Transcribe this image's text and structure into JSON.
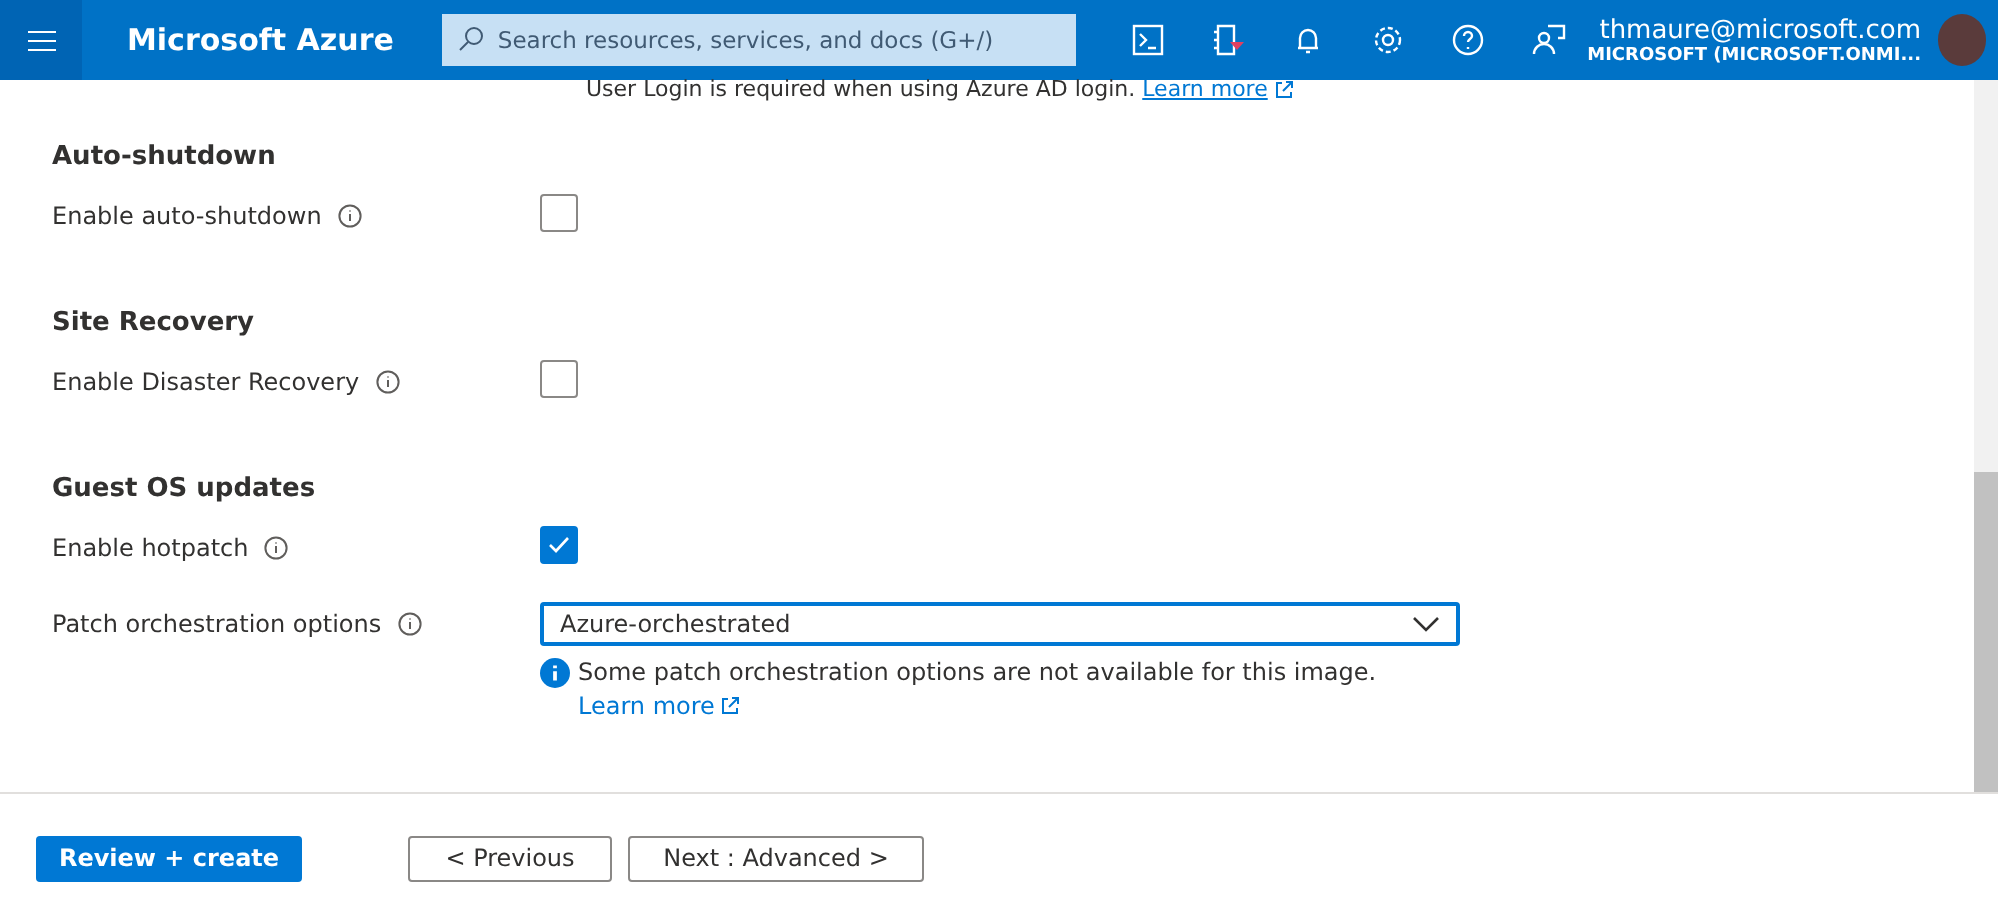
{
  "header": {
    "brand": "Microsoft Azure",
    "search": {
      "placeholder": "Search resources, services, and docs (G+/)"
    },
    "account": {
      "email": "thmaure@microsoft.com",
      "directory": "MICROSOFT (MICROSOFT.ONMI..."
    }
  },
  "top_note": {
    "text": "User Login is required when using Azure AD login.",
    "link": "Learn more"
  },
  "sections": [
    {
      "title": "Auto-shutdown",
      "fields": [
        {
          "kind": "checkbox",
          "label": "Enable auto-shutdown",
          "checked": false
        }
      ]
    },
    {
      "title": "Site Recovery",
      "fields": [
        {
          "kind": "checkbox",
          "label": "Enable Disaster Recovery",
          "checked": false
        }
      ]
    },
    {
      "title": "Guest OS updates",
      "fields": [
        {
          "kind": "checkbox",
          "label": "Enable hotpatch",
          "checked": true
        },
        {
          "kind": "dropdown",
          "label": "Patch orchestration options",
          "value": "Azure-orchestrated",
          "info": "Some patch orchestration options are not available for this image.",
          "link": "Learn more"
        }
      ]
    }
  ],
  "footer": {
    "primary": "Review + create",
    "previous": "< Previous",
    "next": "Next : Advanced >"
  }
}
